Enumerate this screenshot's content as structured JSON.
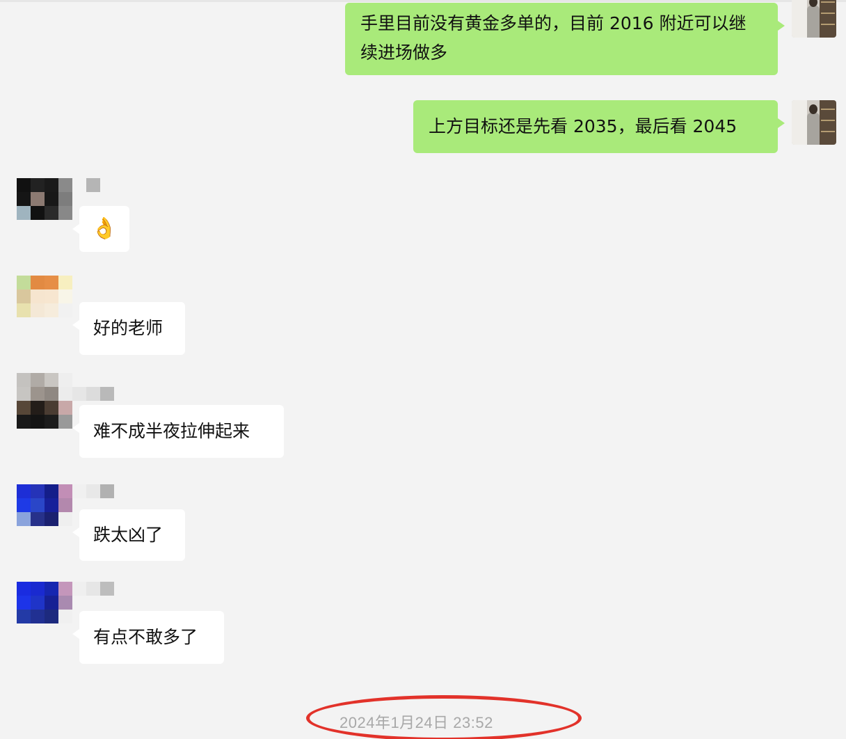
{
  "messages_sent": [
    {
      "text": "手里目前没有黄金多单的，目前 2016 附近可以继续进场做多"
    },
    {
      "text": "上方目标还是先看 2035，最后看 2045"
    }
  ],
  "messages_received": [
    {
      "text": "👌"
    },
    {
      "text": "好的老师"
    },
    {
      "text": "难不成半夜拉伸起来"
    },
    {
      "text": "跌太凶了"
    },
    {
      "text": "有点不敢多了"
    }
  ],
  "timestamp": "2024年1月24日 23:52",
  "colors": {
    "sent_bubble": "#a9ea7a",
    "received_bubble": "#ffffff",
    "background": "#f3f3f3",
    "highlight_ellipse": "#e2322a"
  }
}
